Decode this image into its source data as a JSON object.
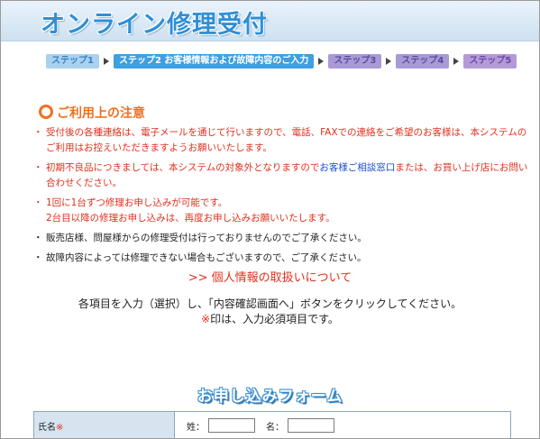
{
  "header": {
    "title": "オンライン修理受付"
  },
  "steps": [
    {
      "label": "ステップ1"
    },
    {
      "label": "ステップ2 お客様情報および故障内容のご入力"
    },
    {
      "label": "ステップ3"
    },
    {
      "label": "ステップ4"
    },
    {
      "label": "ステップ5"
    }
  ],
  "notice": {
    "heading": "ご利用上の注意",
    "items": [
      {
        "text": "受付後の各種連絡は、電子メールを通じて行いますので、電話、FAXでの連絡をご希望のお客様は、本システムのご利用はお控えいただきますようお願いいたします。"
      },
      {
        "text_before": "初期不良品につきましては、本システムの対象外となりますので",
        "link": "お客様ご相談窓口",
        "text_after": "または、お買い上げ店にお問い合わせください。"
      },
      {
        "line1": "1回に1台ずつ修理お申し込みが可能です。",
        "line2": "2台目以降の修理お申し込みは、再度お申し込みお願いいたします。"
      },
      {
        "text": "販売店様、問屋様からの修理受付は行っておりませんのでご了承ください。"
      },
      {
        "text": "故障内容によっては修理できない場合もございますので、ご了承ください。"
      }
    ]
  },
  "privacy_link": ">> 個人情報の取扱いについて",
  "instruction": "各項目を入力（選択）し、「内容確認画面へ」ボタンをクリックしてください。",
  "required_note": {
    "mark": "※",
    "text": "印は、入力必須項目です。"
  },
  "form": {
    "heading": "お申し込みフォーム",
    "name_label": "氏名",
    "required_mark": "※",
    "last_name_label": "姓：",
    "first_name_label": "名："
  },
  "colors": {
    "accent_blue": "#2f8fd6",
    "notice_orange": "#f07020",
    "red_text": "#e0301e",
    "link_blue": "#1a4fc8"
  }
}
